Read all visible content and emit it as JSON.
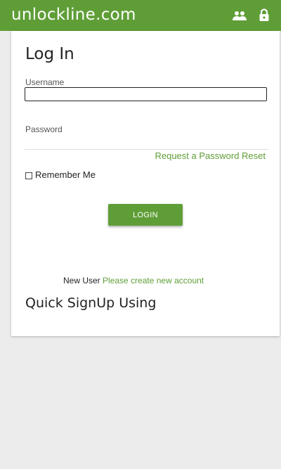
{
  "header": {
    "brand": "unlockline.com",
    "icons": [
      "people-icon",
      "lock-icon"
    ],
    "color": "#5f9e37"
  },
  "login": {
    "title": "Log In",
    "username_label": "Username",
    "username_value": "",
    "password_label": "Password",
    "password_value": "",
    "reset_link": "Request a Password Reset",
    "remember_label": "Remember Me",
    "remember_checked": false,
    "login_button": "LOGIN"
  },
  "signup": {
    "new_user_text": "New User",
    "create_account_link": "Please create new account",
    "quick_signup_title": "Quick SignUp Using"
  },
  "colors": {
    "accent": "#5f9e37",
    "background": "#ececec",
    "card": "#ffffff"
  }
}
